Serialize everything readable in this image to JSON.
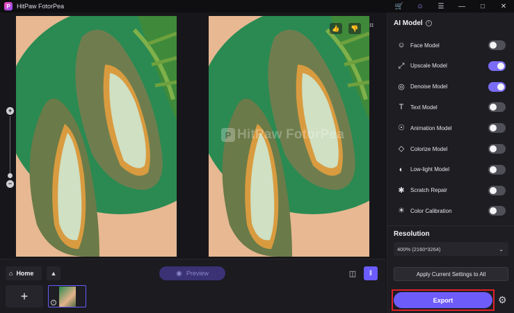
{
  "app": {
    "title": "HitPaw FotorPea",
    "logo_letter": "P"
  },
  "titlebar": {
    "icons": [
      "cart-icon",
      "user-icon",
      "menu-icon",
      "minimize-icon",
      "maximize-icon",
      "close-icon"
    ]
  },
  "canvas": {
    "watermark": "HitPaw FotorPea",
    "zoom": {
      "plus": "+",
      "minus": "−"
    }
  },
  "bottom": {
    "home_label": "Home",
    "preview_label": "Preview"
  },
  "panel": {
    "title": "AI Model",
    "models": [
      {
        "label": "Face Model",
        "icon": "face-icon",
        "on": false
      },
      {
        "label": "Upscale Model",
        "icon": "upscale-icon",
        "on": true
      },
      {
        "label": "Denoise Model",
        "icon": "denoise-icon",
        "on": true
      },
      {
        "label": "Text Model",
        "icon": "text-icon",
        "on": false
      },
      {
        "label": "Animation Model",
        "icon": "animation-icon",
        "on": false
      },
      {
        "label": "Colorize Model",
        "icon": "colorize-icon",
        "on": false
      },
      {
        "label": "Low-light Model",
        "icon": "lowlight-icon",
        "on": false
      },
      {
        "label": "Scratch Repair",
        "icon": "scratch-icon",
        "on": false
      },
      {
        "label": "Color Calibration",
        "icon": "calibration-icon",
        "on": false
      }
    ],
    "resolution_title": "Resolution",
    "resolution_value": "400% (2160*3264)",
    "apply_label": "Apply Current Settings to All",
    "export_label": "Export"
  },
  "colors": {
    "accent": "#6e5cf8",
    "highlight_frame": "#e0202a",
    "background": "#121216"
  }
}
